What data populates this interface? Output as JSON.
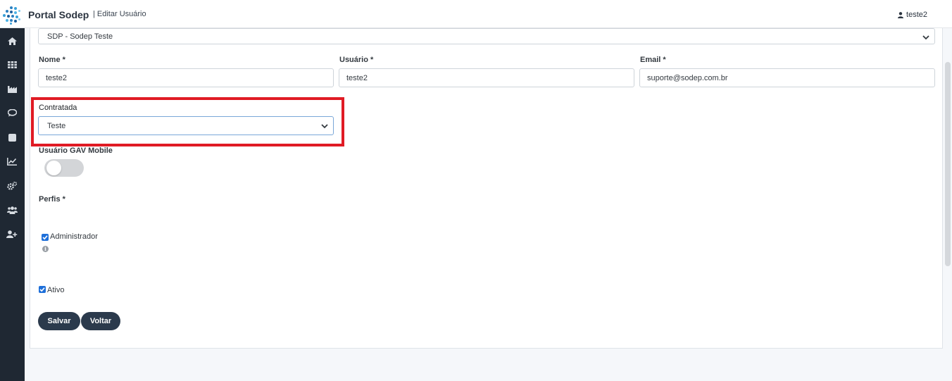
{
  "header": {
    "brand": "Portal Sodep",
    "breadcrumb": "| Editar Usuário",
    "user_name": "teste2"
  },
  "sidebar": {
    "icons": [
      "home-icon",
      "grid-icon",
      "industry-icon",
      "comment-icon",
      "stop-icon",
      "chart-line-icon",
      "cogs-icon",
      "users-icon",
      "user-plus-icon"
    ]
  },
  "form": {
    "company_select": {
      "value": "SDP - Sodep Teste"
    },
    "nome": {
      "label": "Nome *",
      "value": "teste2"
    },
    "usuario": {
      "label": "Usuário *",
      "value": "teste2"
    },
    "email": {
      "label": "Email *",
      "value": "suporte@sodep.com.br"
    },
    "contratada": {
      "label": "Contratada",
      "value": "Teste"
    },
    "gav_mobile": {
      "label": "Usuário GAV Mobile",
      "enabled": false
    },
    "perfis": {
      "label": "Perfis *",
      "items": [
        {
          "label": "Administrador",
          "checked": true
        }
      ]
    },
    "ativo": {
      "label": "Ativo",
      "checked": true
    }
  },
  "actions": {
    "save_label": "Salvar",
    "back_label": "Voltar"
  },
  "colors": {
    "sidebar_bg": "#1f2833",
    "button_bg": "#2b3a4c",
    "highlight": "#e01b24",
    "checkbox": "#1e6fd9"
  }
}
